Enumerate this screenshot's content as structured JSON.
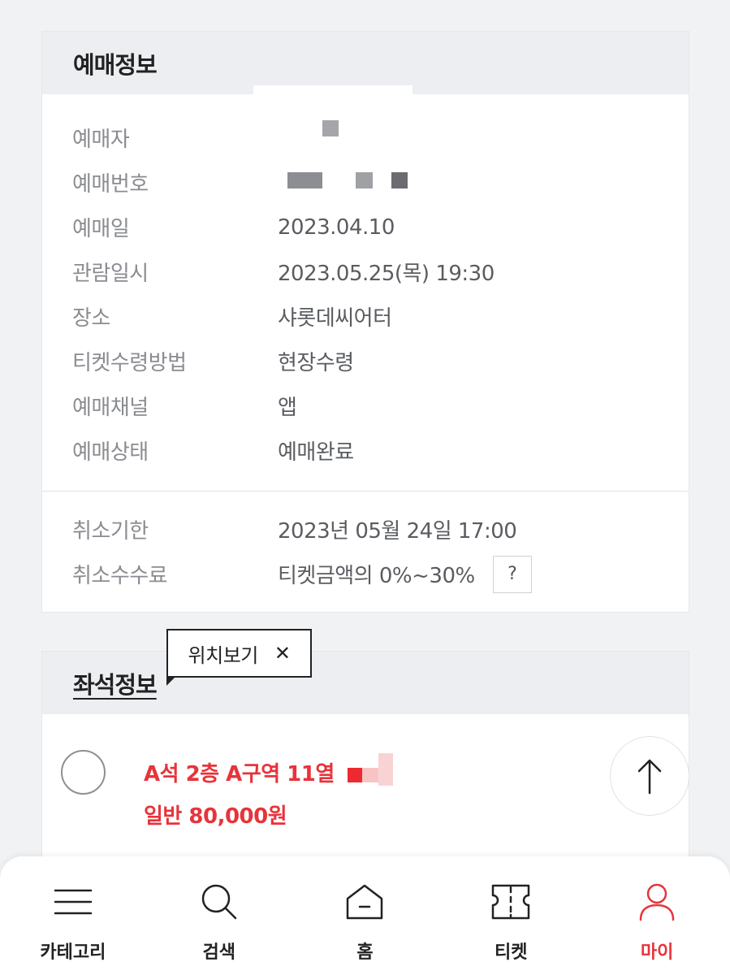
{
  "booking_info": {
    "title": "예매정보",
    "rows": [
      {
        "label": "예매자",
        "value": ""
      },
      {
        "label": "예매번호",
        "value": ""
      },
      {
        "label": "예매일",
        "value": "2023.04.10"
      },
      {
        "label": "관람일시",
        "value": "2023.05.25(목) 19:30"
      },
      {
        "label": "장소",
        "value": "샤롯데씨어터"
      },
      {
        "label": "티켓수령방법",
        "value": "현장수령"
      },
      {
        "label": "예매채널",
        "value": "앱"
      },
      {
        "label": "예매상태",
        "value": "예매완료"
      }
    ],
    "cancel_rows": [
      {
        "label": "취소기한",
        "value": "2023년 05월 24일 17:00"
      },
      {
        "label": "취소수수료",
        "value": "티켓금액의 0%~30%"
      }
    ],
    "help_label": "?"
  },
  "seat_info": {
    "title": "좌석정보",
    "seat": "A석 2층 A구역 11열",
    "price": "일반 80,000원"
  },
  "tooltip": {
    "label": "위치보기",
    "close": "✕"
  },
  "bottom_nav": {
    "items": [
      {
        "label": "카테고리",
        "icon": "menu-icon"
      },
      {
        "label": "검색",
        "icon": "search-icon"
      },
      {
        "label": "홈",
        "icon": "home-icon"
      },
      {
        "label": "티켓",
        "icon": "ticket-icon"
      },
      {
        "label": "마이",
        "icon": "user-icon"
      }
    ]
  },
  "colors": {
    "accent": "#e8333a",
    "label": "#8a8c91",
    "value": "#5a5c61"
  }
}
